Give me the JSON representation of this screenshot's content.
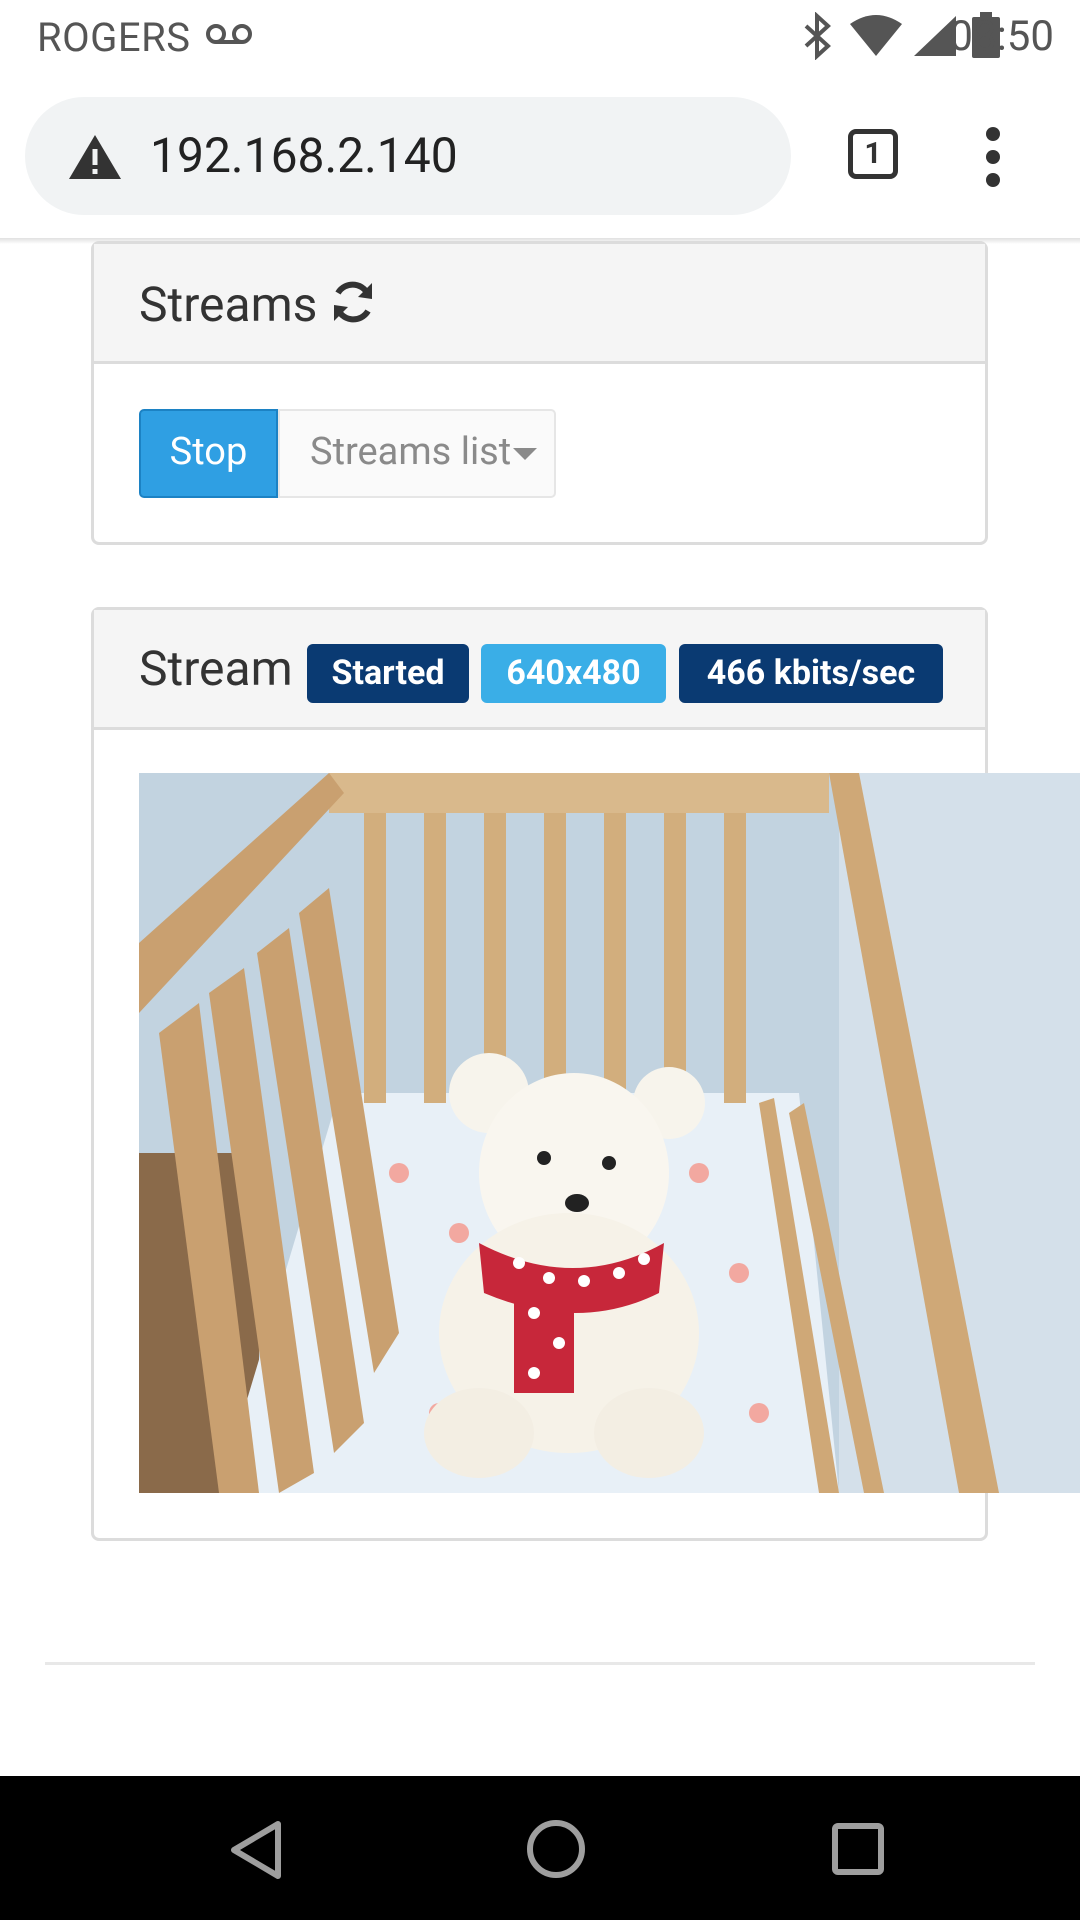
{
  "status_bar": {
    "carrier": "ROGERS",
    "time": "08:50"
  },
  "browser": {
    "url": "192.168.2.140",
    "tab_count": "1"
  },
  "streams_panel": {
    "title": "Streams",
    "stop_label": "Stop",
    "list_label": "Streams list"
  },
  "stream_panel": {
    "title": "Stream",
    "status_badge": "Started",
    "resolution_badge": "640x480",
    "bitrate_badge": "466 kbits/sec",
    "video_description": "Live camera feed of a crib with a white teddy bear wearing a red polka-dot scarf"
  },
  "colors": {
    "accent": "#2f9fe3",
    "badge_dark": "#0a3a72",
    "badge_light": "#3aaee7"
  }
}
